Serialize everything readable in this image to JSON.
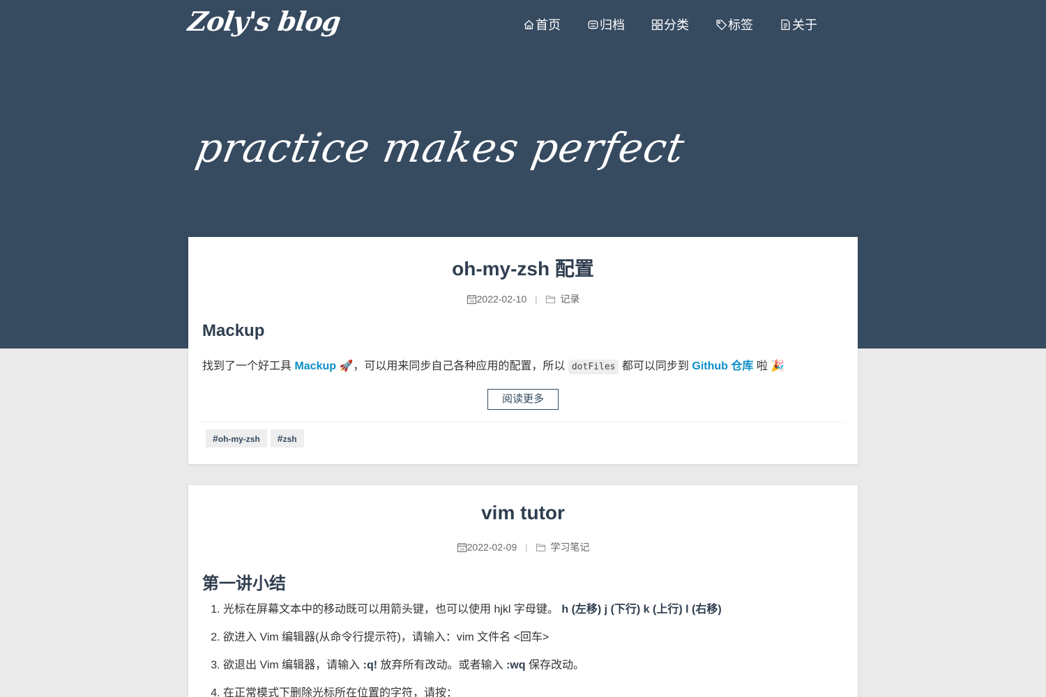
{
  "header": {
    "site_title": "Zoly's blog",
    "nav": [
      {
        "icon": "home-icon",
        "label": "首页"
      },
      {
        "icon": "archive-icon",
        "label": "归档"
      },
      {
        "icon": "grid-icon",
        "label": "分类"
      },
      {
        "icon": "tag-icon",
        "label": "标签"
      },
      {
        "icon": "file-icon",
        "label": "关于"
      }
    ],
    "slogan": "practice makes perfect"
  },
  "colors": {
    "hero_bg": "#364a60",
    "link": "#0c8fc7",
    "text_dark": "#2f3e4f",
    "page_bg": "#eaeaea"
  },
  "posts": [
    {
      "title": "oh-my-zsh 配置",
      "date": "2022-02-10",
      "category": "记录",
      "heading": "Mackup",
      "excerpt": {
        "t1": "找到了一个好工具 ",
        "link1": "Mackup",
        "emoji1": "🚀",
        "t2": "，可以用来同步自己各种应用的配置，所以 ",
        "code": "dotFiles",
        "t3": " 都可以同步到 ",
        "link2": "Github 仓库",
        "t4": " 啦 ",
        "emoji2": "🎉"
      },
      "read_more": "阅读更多",
      "tags": [
        "oh-my-zsh",
        "zsh"
      ]
    },
    {
      "title": "vim tutor",
      "date": "2022-02-09",
      "category": "学习笔记",
      "heading": "第一讲小结",
      "list": [
        {
          "text": "光标在屏幕文本中的移动既可以用箭头键，也可以使用 hjkl 字母键。 ",
          "bold": "h (左移) j (下行) k (上行) l (右移)"
        },
        {
          "text": "欲进入 Vim 编辑器(从命令行提示符)，请输入：vim 文件名 <回车>"
        },
        {
          "pre": "欲退出 Vim 编辑器，请输入 ",
          "b1": ":q!",
          "mid": " 放弃所有改动。或者输入 ",
          "b2": ":wq",
          "post": " 保存改动。"
        },
        {
          "text": "在正常模式下删除光标所在位置的字符，请按："
        }
      ]
    }
  ]
}
